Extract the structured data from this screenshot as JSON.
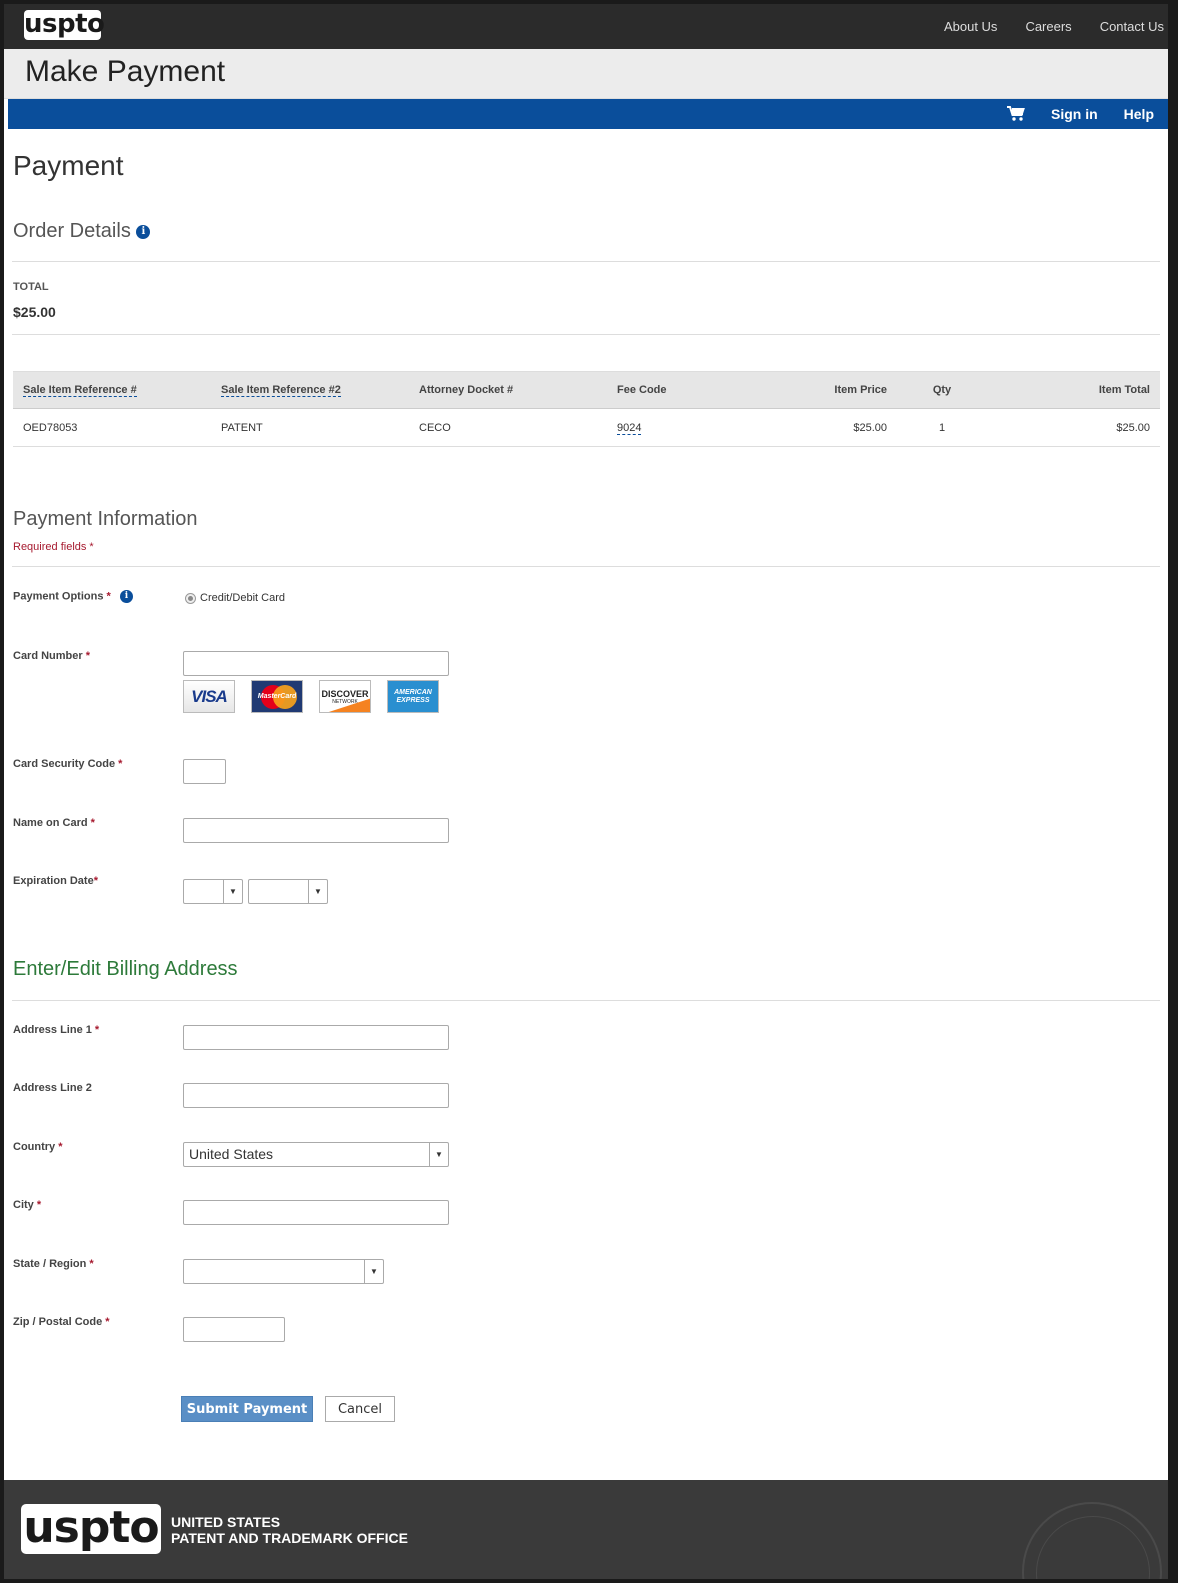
{
  "header": {
    "logo": "uspto",
    "nav": [
      "About Us",
      "Careers",
      "Contact Us"
    ]
  },
  "titlebar": {
    "title": "Make Payment"
  },
  "bluebar": {
    "cart_icon": "shopping-cart-icon",
    "sign_in": "Sign in",
    "help": "Help"
  },
  "page": {
    "heading": "Payment",
    "order_details": "Order Details",
    "total_label": "TOTAL",
    "total_value": "$25.00"
  },
  "table": {
    "headers": [
      "Sale Item Reference #",
      "Sale Item Reference #2",
      "Attorney Docket #",
      "Fee Code",
      "Item Price",
      "Qty",
      "Item Total"
    ],
    "rows": [
      [
        "OED78053",
        "PATENT",
        "CECO",
        "9024",
        "$25.00",
        "1",
        "$25.00"
      ]
    ]
  },
  "payment_info": {
    "heading": "Payment Information",
    "required_note": "Required fields",
    "payment_options_label": "Payment Options",
    "payment_option": "Credit/Debit Card",
    "card_number_label": "Card Number",
    "card_logos": [
      "VISA",
      "MasterCard",
      "DISCOVER",
      "NETWORK",
      "AMERICAN",
      "EXPRESS"
    ],
    "security_code_label": "Card Security Code",
    "name_label": "Name on Card",
    "expiration_label": "Expiration Date"
  },
  "billing": {
    "heading": "Enter/Edit Billing Address",
    "address1_label": "Address Line 1",
    "address2_label": "Address Line 2",
    "country_label": "Country",
    "country_value": "United States",
    "city_label": "City",
    "state_label": "State / Region",
    "zip_label": "Zip / Postal Code"
  },
  "actions": {
    "submit": "Submit Payment",
    "cancel": "Cancel"
  },
  "footer": {
    "logo": "uspto",
    "line1": "UNITED STATES",
    "line2": "PATENT AND TRADEMARK OFFICE"
  },
  "colors": {
    "nav_blue": "#0a4e9b",
    "required_red": "#a6192e",
    "billing_green": "#2d7a3a",
    "button_blue": "#5a8fc6"
  }
}
